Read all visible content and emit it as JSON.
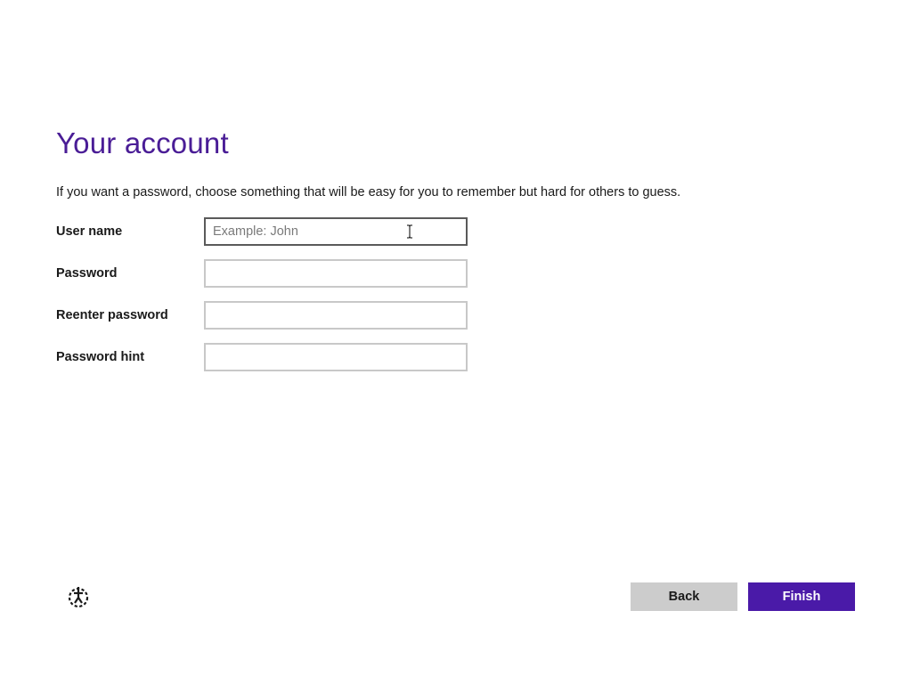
{
  "page": {
    "title": "Your account",
    "description": "If you want a password, choose something that will be easy for you to remember but hard for others to guess."
  },
  "form": {
    "username": {
      "label": "User name",
      "placeholder": "Example: John",
      "value": ""
    },
    "password": {
      "label": "Password",
      "placeholder": "",
      "value": ""
    },
    "reenter_password": {
      "label": "Reenter password",
      "placeholder": "",
      "value": ""
    },
    "password_hint": {
      "label": "Password hint",
      "placeholder": "",
      "value": ""
    }
  },
  "buttons": {
    "back_label": "Back",
    "finish_label": "Finish"
  },
  "icons": {
    "ease_of_access": "ease-of-access-icon",
    "text_cursor": "i-beam-cursor-icon"
  },
  "colors": {
    "accent": "#4a1aa8",
    "title": "#4a1d96",
    "back_button": "#cccccc"
  }
}
